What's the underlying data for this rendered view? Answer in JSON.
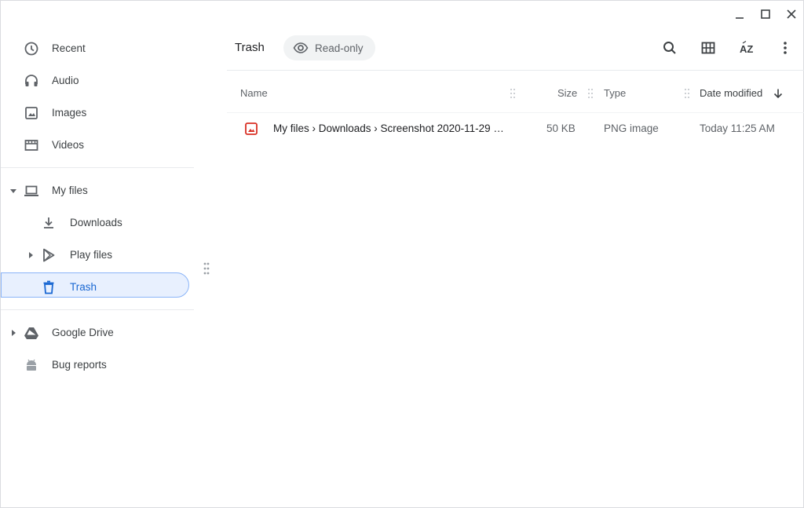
{
  "window": {
    "controls": [
      "minimize-icon",
      "maximize-icon",
      "close-icon"
    ]
  },
  "sidebar": {
    "recent": "Recent",
    "audio": "Audio",
    "images": "Images",
    "videos": "Videos",
    "my_files": "My files",
    "downloads": "Downloads",
    "play_files": "Play files",
    "trash": "Trash",
    "google_drive": "Google Drive",
    "bug_reports": "Bug reports"
  },
  "header": {
    "title": "Trash",
    "readonly_label": "Read-only"
  },
  "toolbar": {
    "icons": [
      "search-icon",
      "grid-view-icon",
      "sort-az-icon",
      "more-vert-icon"
    ]
  },
  "table": {
    "columns": {
      "name": "Name",
      "size": "Size",
      "type": "Type",
      "date": "Date modified"
    },
    "sort": "descending by Date modified",
    "rows": [
      {
        "name": "My files › Downloads › Screenshot 2020-11-29 …",
        "size": "50 KB",
        "type": "PNG image",
        "date": "Today 11:25 AM"
      }
    ]
  },
  "colors": {
    "accent": "#1967d2",
    "selected_bg": "#e8f0fe",
    "selected_border": "#8ab4f8",
    "file_icon": "#d93025",
    "text": "#3c4043",
    "muted": "#5f6368"
  }
}
